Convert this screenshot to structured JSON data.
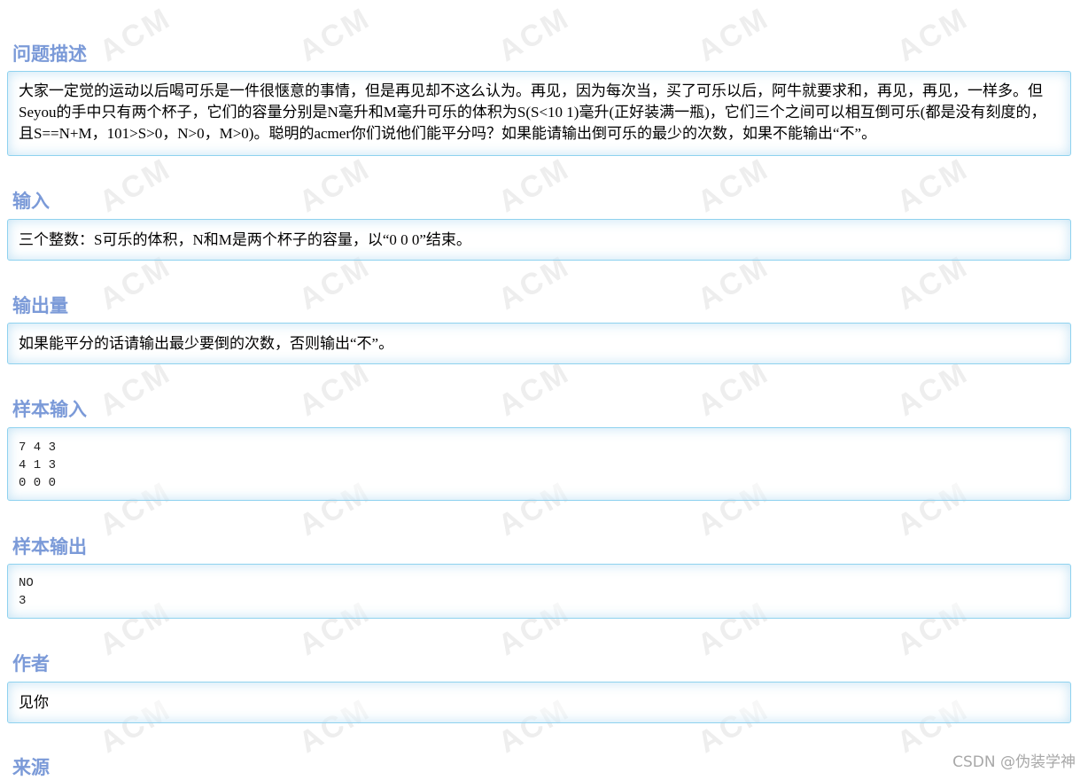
{
  "watermark_text": "ACM",
  "sections": {
    "description": {
      "title": "问题描述",
      "text": "大家一定觉的运动以后喝可乐是一件很惬意的事情，但是再见却不这么认为。再见，因为每次当，买了可乐以后，阿牛就要求和，再见，再见，一样多。但Seyou的手中只有两个杯子，它们的容量分别是N毫升和M毫升可乐的体积为S(S<10 1)毫升(正好装满一瓶)，它们三个之间可以相互倒可乐(都是没有刻度的，且S==N+M，101>S>0，N>0，M>0)。聪明的acmer你们说他们能平分吗？如果能请输出倒可乐的最少的次数，如果不能输出“不”。"
    },
    "input": {
      "title": "输入",
      "text": "三个整数：S可乐的体积，N和M是两个杯子的容量，以“0 0 0”结束。"
    },
    "output": {
      "title": "输出量",
      "text": "如果能平分的话请输出最少要倒的次数，否则输出“不”。"
    },
    "sample_input": {
      "title": "样本输入",
      "text": "7 4 3\n4 1 3\n0 0 0"
    },
    "sample_output": {
      "title": "样本输出",
      "text": "NO\n3"
    },
    "author": {
      "title": "作者",
      "text": "见你"
    },
    "source": {
      "title": "来源"
    }
  },
  "footer": {
    "csdn_watermark": "CSDN @伪装学神"
  }
}
